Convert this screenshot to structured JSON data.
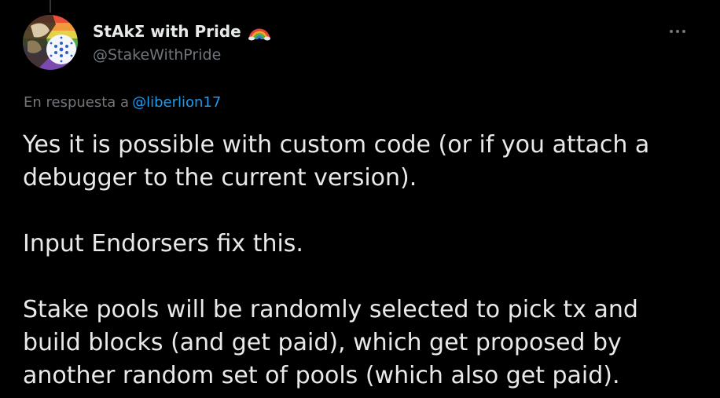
{
  "tweet": {
    "display_name": "StAkΣ with Pride",
    "flag_icon": "rainbow-icon",
    "handle": "@StakeWithPride",
    "more_icon": "more-options-icon",
    "reply_prefix": "En respuesta a",
    "reply_to": "@liberlion17",
    "paragraphs": [
      "Yes it is possible with custom code (or if you attach a debugger to the current version).",
      "Input Endorsers fix this.",
      "Stake pools will be randomly selected to pick tx and build blocks (and get paid), which get proposed by another random set of pools (which also get paid)."
    ]
  },
  "colors": {
    "background": "#000000",
    "text": "#e7e9ea",
    "muted": "#71767b",
    "link": "#1d9bf0"
  }
}
